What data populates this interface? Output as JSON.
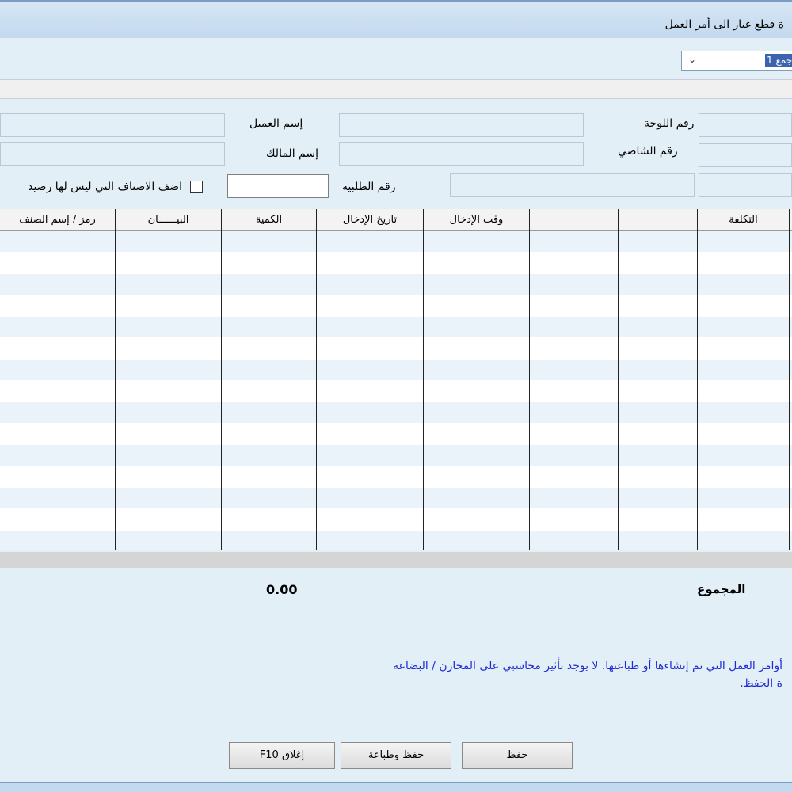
{
  "window": {
    "title": "ة قطع غيار الى أمر العمل"
  },
  "selector": {
    "value": "جمع 1"
  },
  "fields": {
    "plate_label": "رقم اللوحة",
    "customer_label": "إسم العميل",
    "chassis_label": "رقم الشاصي",
    "owner_label": "إسم المالك",
    "order_label": "رقم الطلبية",
    "add_items_label": "اضف الاصناف التي ليس لها رصيد"
  },
  "table": {
    "columns": [
      "رمز / إسم الصنف",
      "البيــــــان",
      "الكمية",
      "تاريخ الإدخال",
      "وقت الإدخال",
      "",
      "",
      "التكلفة"
    ],
    "rows": []
  },
  "totals": {
    "label": "المجموع",
    "value": "0.00"
  },
  "note": {
    "line1": "أوامر العمل التي تم إنشاءها أو طباعتها. لا يوجد تأثير محاسبي على المخازن / البضاعة",
    "line2": "ة الحفظ."
  },
  "buttons": {
    "save": "حفظ",
    "save_print": "حفظ وطباعة",
    "close": "إغلاق F10"
  }
}
